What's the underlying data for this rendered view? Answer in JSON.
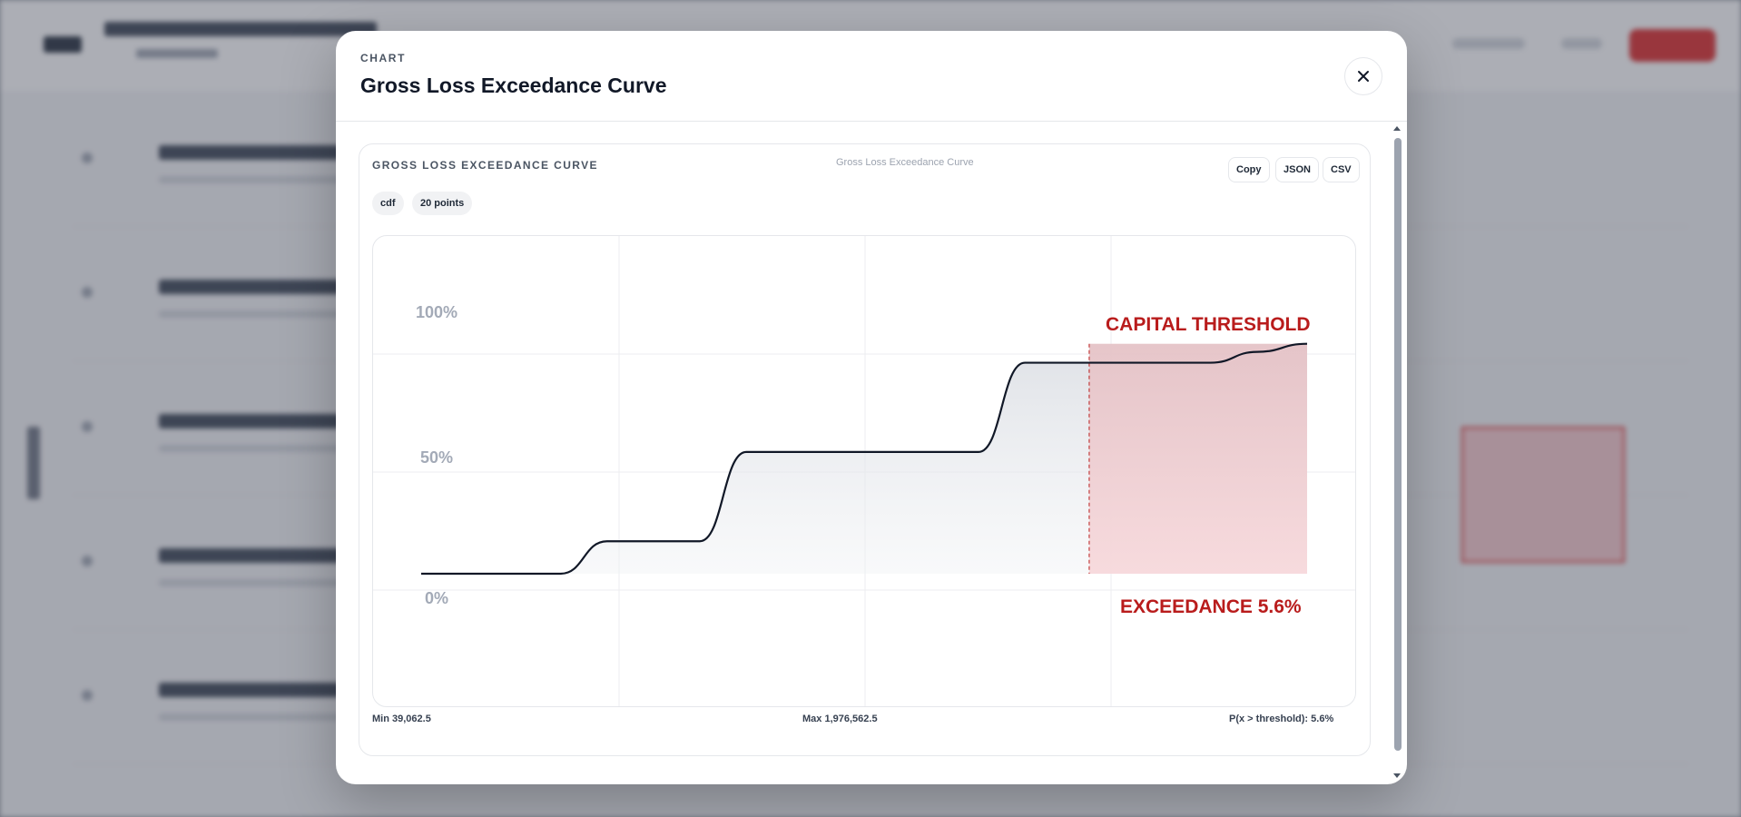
{
  "modal": {
    "kicker": "CHART",
    "title": "Gross Loss Exceedance Curve"
  },
  "card": {
    "title": "GROSS LOSS EXCEEDANCE CURVE",
    "center_label": "Gross Loss Exceedance Curve",
    "buttons": {
      "copy": "Copy",
      "json": "JSON",
      "csv": "CSV"
    },
    "chips": {
      "mode": "cdf",
      "points": "20 points"
    },
    "footer": {
      "min": "Min 39,062.5",
      "max": "Max 1,976,562.5",
      "prob": "P(x > threshold): 5.6%"
    }
  },
  "icons": {
    "close": "close-icon"
  },
  "colors": {
    "line": "#111827",
    "threshold": "#b91c1c",
    "exceed_fill": "#f5d0d3"
  },
  "chart_data": {
    "type": "line",
    "x": [
      39062.5,
      140625,
      242187.5,
      343750,
      445312.5,
      546875,
      648437.5,
      750000,
      851562.5,
      953125,
      1054687.5,
      1156250,
      1257812.5,
      1359375,
      1460937.5,
      1562500,
      1664062.5,
      1765625,
      1867187.5,
      1976562.5
    ],
    "y": [
      0.0,
      0.0,
      0.0,
      0.0,
      0.12,
      0.12,
      0.12,
      0.45,
      0.45,
      0.45,
      0.45,
      0.45,
      0.45,
      0.78,
      0.78,
      0.78,
      0.78,
      0.78,
      0.82,
      0.85
    ],
    "ylim": [
      0,
      1
    ],
    "y_ticks": [
      "0%",
      "50%",
      "100%"
    ],
    "threshold_x": 1500000,
    "annotations": {
      "threshold": "CAPITAL THRESHOLD",
      "exceedance": "EXCEEDANCE 5.6%"
    },
    "grid": true
  }
}
